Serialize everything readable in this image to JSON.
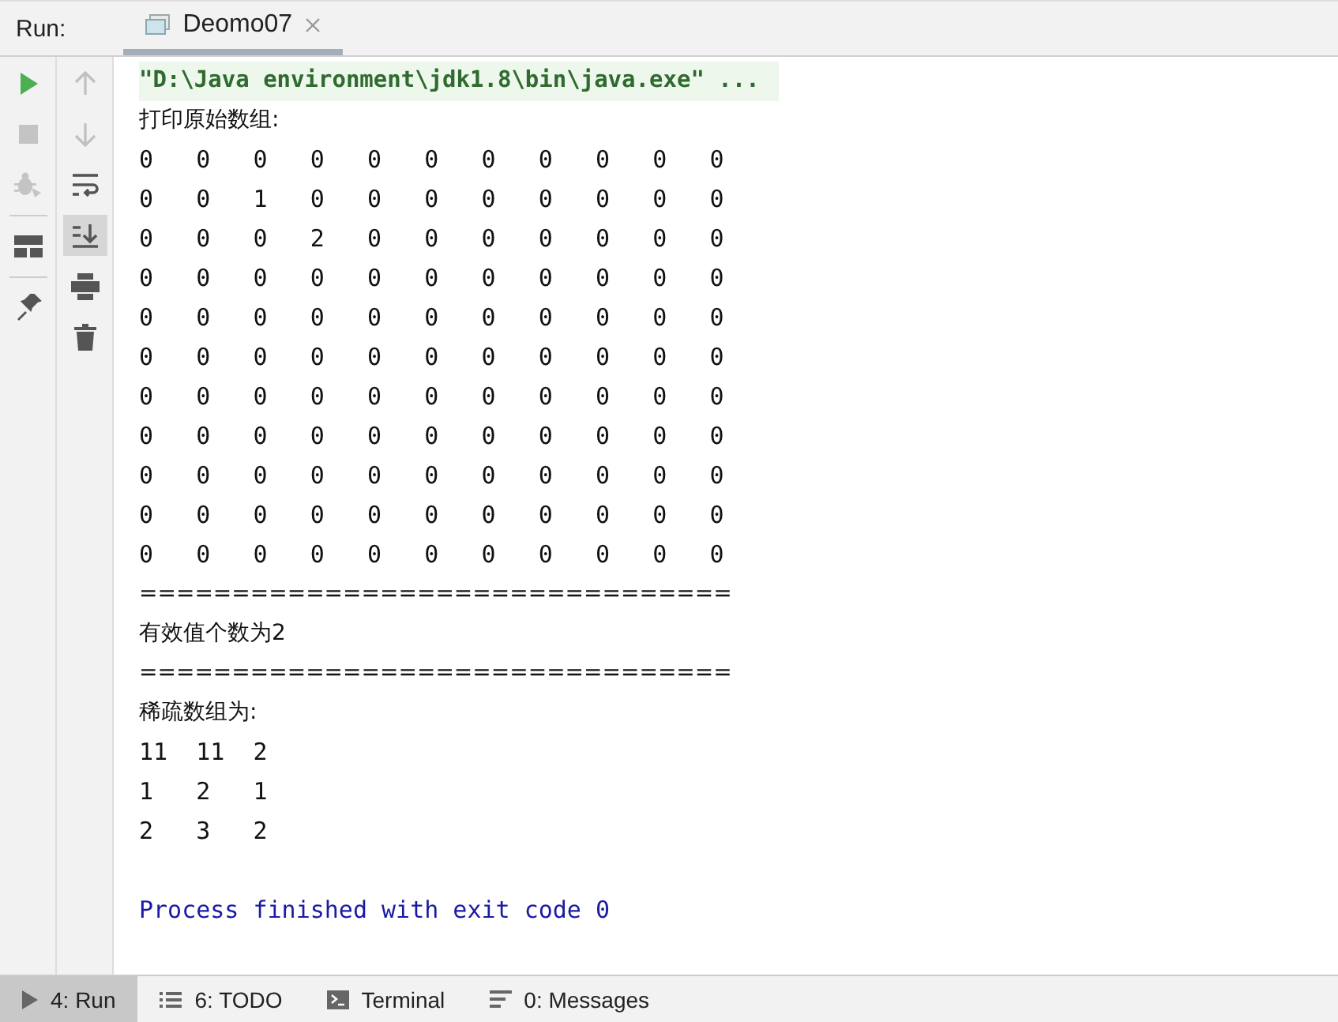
{
  "header": {
    "label": "Run:",
    "tab": {
      "title": "Deomo07",
      "selected": true
    }
  },
  "left_toolbar": [
    {
      "disabled": false
    },
    {
      "disabled": true
    },
    {
      "disabled": true
    },
    {
      "disabled": false
    },
    {
      "disabled": false
    }
  ],
  "right_toolbar": [
    {
      "disabled": true,
      "selected": false
    },
    {
      "disabled": true,
      "selected": false
    },
    {
      "disabled": false,
      "selected": false
    },
    {
      "disabled": false,
      "selected": true
    },
    {
      "disabled": false,
      "selected": false
    },
    {
      "disabled": false,
      "selected": false
    }
  ],
  "console": [
    {
      "kind": "command",
      "text": "\"D:\\Java environment\\jdk1.8\\bin\\java.exe\" ..."
    },
    {
      "kind": "text",
      "text": "打印原始数组:"
    },
    {
      "kind": "mono",
      "text": "0\t0\t0\t0\t0\t0\t0\t0\t0\t0\t0"
    },
    {
      "kind": "mono",
      "text": "0\t0\t1\t0\t0\t0\t0\t0\t0\t0\t0"
    },
    {
      "kind": "mono",
      "text": "0\t0\t0\t2\t0\t0\t0\t0\t0\t0\t0"
    },
    {
      "kind": "mono",
      "text": "0\t0\t0\t0\t0\t0\t0\t0\t0\t0\t0"
    },
    {
      "kind": "mono",
      "text": "0\t0\t0\t0\t0\t0\t0\t0\t0\t0\t0"
    },
    {
      "kind": "mono",
      "text": "0\t0\t0\t0\t0\t0\t0\t0\t0\t0\t0"
    },
    {
      "kind": "mono",
      "text": "0\t0\t0\t0\t0\t0\t0\t0\t0\t0\t0"
    },
    {
      "kind": "mono",
      "text": "0\t0\t0\t0\t0\t0\t0\t0\t0\t0\t0"
    },
    {
      "kind": "mono",
      "text": "0\t0\t0\t0\t0\t0\t0\t0\t0\t0\t0"
    },
    {
      "kind": "mono",
      "text": "0\t0\t0\t0\t0\t0\t0\t0\t0\t0\t0"
    },
    {
      "kind": "mono",
      "text": "0\t0\t0\t0\t0\t0\t0\t0\t0\t0\t0"
    },
    {
      "kind": "text",
      "text": "================================"
    },
    {
      "kind": "text",
      "text": "有效值个数为2"
    },
    {
      "kind": "text",
      "text": "================================"
    },
    {
      "kind": "text",
      "text": "稀疏数组为:"
    },
    {
      "kind": "mono",
      "text": "11\t11\t2"
    },
    {
      "kind": "mono",
      "text": "1\t2\t1"
    },
    {
      "kind": "mono",
      "text": "2\t3\t2"
    },
    {
      "kind": "blank"
    },
    {
      "kind": "exit",
      "text": "Process finished with exit code 0"
    }
  ],
  "bottom_tabs": [
    {
      "label": "4: Run",
      "selected": true
    },
    {
      "label": "6: TODO",
      "selected": false
    },
    {
      "label": "Terminal",
      "selected": false
    },
    {
      "label": "0: Messages",
      "selected": false
    }
  ]
}
